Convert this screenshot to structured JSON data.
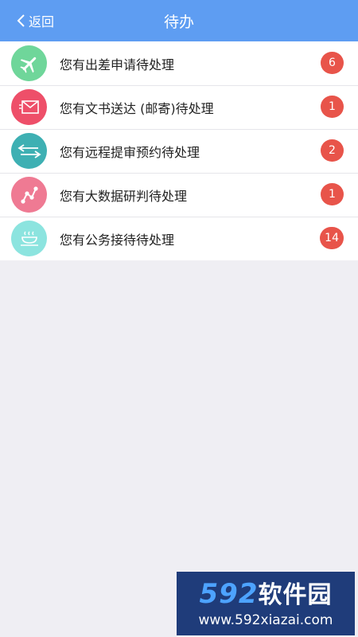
{
  "nav": {
    "back_label": "返回",
    "title": "待办"
  },
  "items": [
    {
      "prefix": "您有",
      "name": "出差申请",
      "suffix": "待处理",
      "count": "6",
      "icon": "airplane-icon",
      "color": "#6fd69a"
    },
    {
      "prefix": "您有",
      "name": "文书送达 (邮寄)",
      "suffix": "待处理",
      "count": "1",
      "icon": "mail-icon",
      "color": "#ee4f69"
    },
    {
      "prefix": "您有",
      "name": "远程提审预约",
      "suffix": "待处理",
      "count": "2",
      "icon": "exchange-arrows-icon",
      "color": "#3eb0b3"
    },
    {
      "prefix": "您有",
      "name": "大数据研判",
      "suffix": "待处理",
      "count": "1",
      "icon": "data-trend-icon",
      "color": "#ef7a93"
    },
    {
      "prefix": "您有",
      "name": "公务接待",
      "suffix": "待处理",
      "count": "14",
      "icon": "coffee-cup-icon",
      "color": "#8ce4df"
    }
  ],
  "watermark": {
    "logo_num": "592",
    "logo_cn": "软件园",
    "url": "www.592xiazai.com"
  }
}
